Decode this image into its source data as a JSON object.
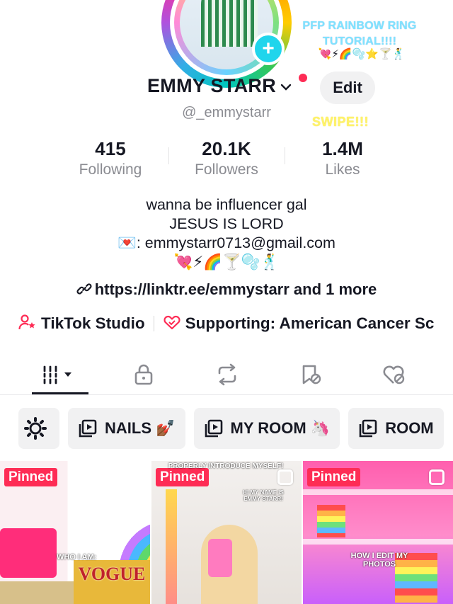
{
  "profile": {
    "name": "EMMY STARR",
    "handle": "@_emmystarr",
    "edit_label": "Edit",
    "add_icon": "plus-icon"
  },
  "overlay": {
    "note": "PFP RAINBOW RING TUTORIAL!!!!",
    "emojis": "💘⚡🌈🫧⭐🍸🕺",
    "swipe": "SWIPE!!!"
  },
  "stats": [
    {
      "value": "415",
      "label": "Following"
    },
    {
      "value": "20.1K",
      "label": "Followers"
    },
    {
      "value": "1.4M",
      "label": "Likes"
    }
  ],
  "bio": {
    "line1": "wanna be influencer gal",
    "line2": "JESUS IS LORD",
    "line3": "💌: emmystarr0713@gmail.com",
    "line4": "💘⚡🌈🍸🫧🕺"
  },
  "link": {
    "text": "https://linktr.ee/emmystarr and 1 more"
  },
  "chips": {
    "studio": "TikTok Studio",
    "supporting": "Supporting: American Cancer Sc"
  },
  "tabs": [
    "videos-grid-icon",
    "lock-icon",
    "repost-icon",
    "saved-icon",
    "liked-icon"
  ],
  "collections": [
    {
      "label": "NAILS 💅🏾"
    },
    {
      "label": "MY ROOM 🦄"
    },
    {
      "label": "ROOM"
    }
  ],
  "videos": [
    {
      "badge": "Pinned",
      "caption_top": "",
      "caption_mid": "WHO I AM:",
      "caption_big": "VOGUE"
    },
    {
      "badge": "Pinned",
      "caption_top": "PROPERLY INTRODUCE MYSELF!",
      "caption_mid": "HI MY NAME IS EMMY STARR!",
      "caption_big": ""
    },
    {
      "badge": "Pinned",
      "caption_top": "",
      "caption_mid": "HOW I EDIT MY PHOTOS",
      "caption_big": ""
    }
  ],
  "colors": {
    "accent_red": "#fe2c55",
    "plus_blue": "#20d5ec",
    "overlay_blue": "#7fe3ff",
    "swipe_yellow": "#fff36a"
  }
}
